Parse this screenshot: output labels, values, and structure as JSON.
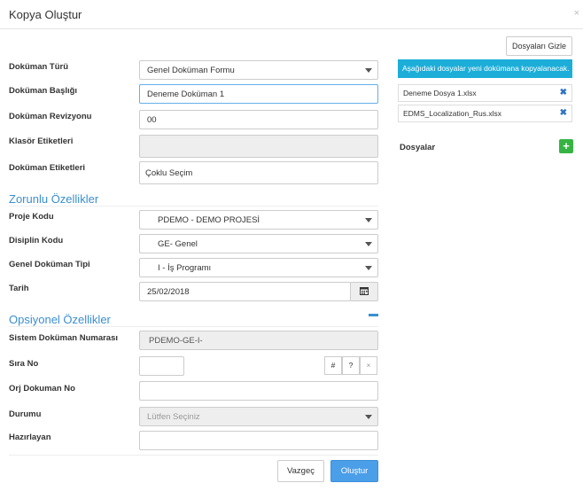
{
  "modal": {
    "title": "Kopya Oluştur",
    "close_icon": "×"
  },
  "toolbar": {
    "hide_files_label": "Dosyaları Gizle"
  },
  "fields": {
    "doc_type": {
      "label": "Doküman Türü",
      "value": "Genel Doküman Formu"
    },
    "doc_title": {
      "label": "Doküman Başlığı",
      "value": "Deneme Doküman 1"
    },
    "doc_revision": {
      "label": "Doküman Revizyonu",
      "value": "00"
    },
    "folder_tags": {
      "label": "Klasör Etiketleri",
      "value": ""
    },
    "doc_tags": {
      "label": "Doküman Etiketleri",
      "placeholder": "Çoklu Seçim"
    }
  },
  "required_section": {
    "title": "Zorunlu Özellikler",
    "project_code": {
      "label": "Proje Kodu",
      "value": "PDEMO - DEMO PROJESİ"
    },
    "discipline_code": {
      "label": "Disiplin Kodu",
      "value": "GE- Genel"
    },
    "general_doc_type": {
      "label": "Genel Doküman Tipi",
      "value": "I - İş Programı"
    },
    "date": {
      "label": "Tarih",
      "value": "25/02/2018"
    }
  },
  "optional_section": {
    "title": "Opsiyonel Özellikler",
    "collapse_icon": "minus",
    "system_doc_number": {
      "label": "Sistem Doküman Numarası",
      "value": "PDEMO-GE-I-"
    },
    "sequence_no": {
      "label": "Sıra No",
      "value": "",
      "hash_btn": "#",
      "question_btn": "?",
      "clear_btn": "×"
    },
    "orig_doc_no": {
      "label": "Orj Dokuman No",
      "value": ""
    },
    "status": {
      "label": "Durumu",
      "value": "Lütfen Seçiniz"
    },
    "prepared_by": {
      "label": "Hazırlayan",
      "value": ""
    }
  },
  "files_panel": {
    "notice": "Aşağıdaki dosyalar yeni dokümana kopyalanacak.",
    "files": [
      {
        "name": "Deneme Dosya 1.xlsx"
      },
      {
        "name": "EDMS_Localization_Rus.xlsx"
      }
    ],
    "files_label": "Dosyalar",
    "add_icon": "+"
  },
  "actions": {
    "cancel_label": "Vazgeç",
    "create_label": "Oluştur"
  },
  "colors": {
    "accent": "#3a8fd1",
    "primary": "#4b9ee8",
    "notice_bg": "#1caed9",
    "add_btn": "#36b443",
    "remove_icon": "#2f73c2"
  }
}
